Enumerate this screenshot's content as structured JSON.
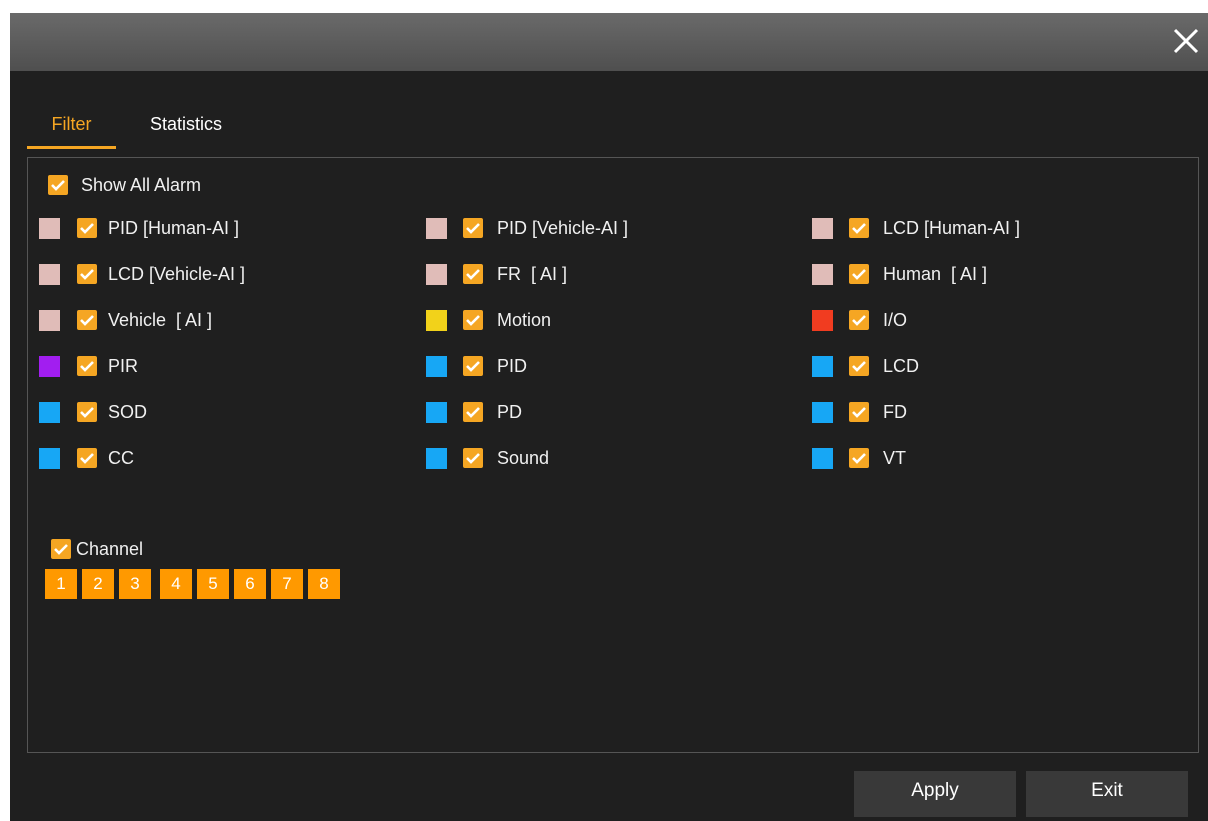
{
  "colors": {
    "accent": "#f5a623",
    "ai": "#e0bcb8",
    "motion": "#f2d21a",
    "io": "#f13c20",
    "pir": "#a21ef0",
    "smart": "#17a7f5"
  },
  "close_icon": "close-icon",
  "tabs": [
    {
      "label": "Filter"
    },
    {
      "label": "Statistics"
    }
  ],
  "show_all": {
    "label": "Show All Alarm",
    "checked": true
  },
  "alarms": [
    {
      "label": "PID [Human-AI ]",
      "color": "#e0bcb8",
      "checked": true
    },
    {
      "label": "PID [Vehicle-AI ]",
      "color": "#e0bcb8",
      "checked": true
    },
    {
      "label": "LCD [Human-AI ]",
      "color": "#e0bcb8",
      "checked": true
    },
    {
      "label": "LCD [Vehicle-AI ]",
      "color": "#e0bcb8",
      "checked": true
    },
    {
      "label": "FR  [ AI ]",
      "color": "#e0bcb8",
      "checked": true
    },
    {
      "label": "Human  [ AI ]",
      "color": "#e0bcb8",
      "checked": true
    },
    {
      "label": "Vehicle  [ AI ]",
      "color": "#e0bcb8",
      "checked": true
    },
    {
      "label": "Motion",
      "color": "#f2d21a",
      "checked": true
    },
    {
      "label": "I/O",
      "color": "#f13c20",
      "checked": true
    },
    {
      "label": "PIR",
      "color": "#a21ef0",
      "checked": true
    },
    {
      "label": "PID",
      "color": "#17a7f5",
      "checked": true
    },
    {
      "label": "LCD",
      "color": "#17a7f5",
      "checked": true
    },
    {
      "label": "SOD",
      "color": "#17a7f5",
      "checked": true
    },
    {
      "label": "PD",
      "color": "#17a7f5",
      "checked": true
    },
    {
      "label": "FD",
      "color": "#17a7f5",
      "checked": true
    },
    {
      "label": "CC",
      "color": "#17a7f5",
      "checked": true
    },
    {
      "label": "Sound",
      "color": "#17a7f5",
      "checked": true
    },
    {
      "label": "VT",
      "color": "#17a7f5",
      "checked": true
    }
  ],
  "channel": {
    "label": "Channel",
    "checked": true,
    "channels": [
      "1",
      "2",
      "3",
      "4",
      "5",
      "6",
      "7",
      "8"
    ]
  },
  "buttons": {
    "apply": "Apply",
    "exit": "Exit"
  }
}
